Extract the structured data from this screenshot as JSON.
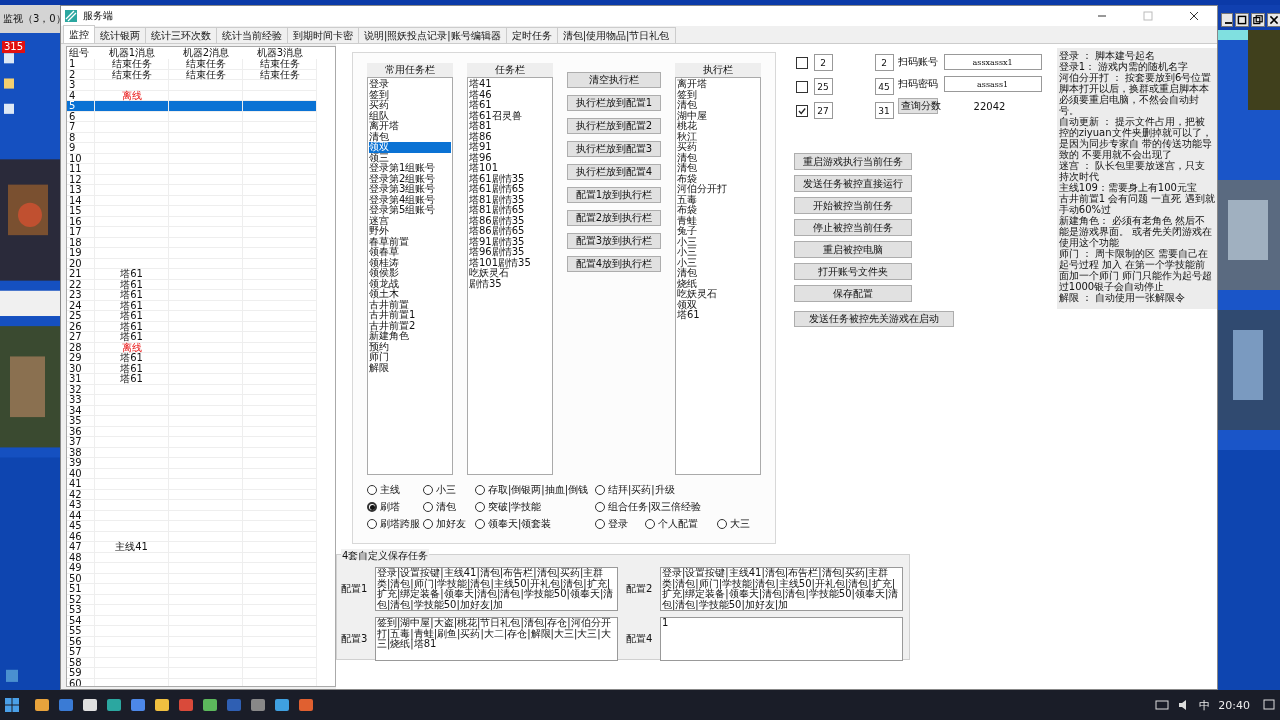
{
  "background_window": {
    "title": "监视（3，0）",
    "badge": "315"
  },
  "window": {
    "title": "服务端"
  },
  "tabs": [
    {
      "label": "监控",
      "selected": true
    },
    {
      "label": "统计银两",
      "selected": false
    },
    {
      "label": "统计三环次数",
      "selected": false
    },
    {
      "label": "统计当前经验",
      "selected": false
    },
    {
      "label": "到期时间卡密",
      "selected": false
    },
    {
      "label": "说明|照妖投点记录|账号编辑器",
      "selected": false
    },
    {
      "label": "定时任务",
      "selected": false
    },
    {
      "label": "清包|使用物品|节日礼包",
      "selected": false
    }
  ],
  "monitor_table": {
    "columns": [
      "组号",
      "机器1消息",
      "机器2消息",
      "机器3消息"
    ],
    "rows": [
      {
        "no": "1",
        "m1": "结束任务",
        "m2": "结束任务",
        "m3": "结束任务",
        "selected": false,
        "alert": false
      },
      {
        "no": "2",
        "m1": "结束任务",
        "m2": "结束任务",
        "m3": "结束任务",
        "selected": false,
        "alert": false
      },
      {
        "no": "3",
        "selected": false
      },
      {
        "no": "4",
        "m1": "离线",
        "selected": false,
        "alert": true
      },
      {
        "no": "5",
        "selected": true
      },
      {
        "no": "6",
        "selected": false
      },
      {
        "no": "7",
        "selected": false
      },
      {
        "no": "8",
        "selected": false
      },
      {
        "no": "9",
        "selected": false
      },
      {
        "no": "10",
        "selected": false
      },
      {
        "no": "11",
        "selected": false
      },
      {
        "no": "12",
        "selected": false
      },
      {
        "no": "13",
        "selected": false
      },
      {
        "no": "14",
        "selected": false
      },
      {
        "no": "15",
        "selected": false
      },
      {
        "no": "16",
        "selected": false
      },
      {
        "no": "17",
        "selected": false
      },
      {
        "no": "18",
        "selected": false
      },
      {
        "no": "19",
        "selected": false
      },
      {
        "no": "20",
        "selected": false
      },
      {
        "no": "21",
        "m1": "塔61",
        "selected": false,
        "alert": false
      },
      {
        "no": "22",
        "m1": "塔61",
        "selected": false,
        "alert": false
      },
      {
        "no": "23",
        "m1": "塔61",
        "selected": false,
        "alert": false
      },
      {
        "no": "24",
        "m1": "塔61",
        "selected": false,
        "alert": false
      },
      {
        "no": "25",
        "m1": "塔61",
        "selected": false,
        "alert": false
      },
      {
        "no": "26",
        "m1": "塔61",
        "selected": false,
        "alert": false
      },
      {
        "no": "27",
        "m1": "塔61",
        "selected": false,
        "alert": false
      },
      {
        "no": "28",
        "m1": "离线",
        "selected": false,
        "alert": true
      },
      {
        "no": "29",
        "m1": "塔61",
        "selected": false,
        "alert": false
      },
      {
        "no": "30",
        "m1": "塔61",
        "selected": false,
        "alert": false
      },
      {
        "no": "31",
        "m1": "塔61",
        "selected": false,
        "alert": false
      },
      {
        "no": "32",
        "selected": false
      },
      {
        "no": "33",
        "selected": false
      },
      {
        "no": "34",
        "selected": false
      },
      {
        "no": "35",
        "selected": false
      },
      {
        "no": "36",
        "selected": false
      },
      {
        "no": "37",
        "selected": false
      },
      {
        "no": "38",
        "selected": false
      },
      {
        "no": "39",
        "selected": false
      },
      {
        "no": "40",
        "selected": false
      },
      {
        "no": "41",
        "selected": false
      },
      {
        "no": "42",
        "selected": false
      },
      {
        "no": "43",
        "selected": false
      },
      {
        "no": "44",
        "selected": false
      },
      {
        "no": "45",
        "selected": false
      },
      {
        "no": "46",
        "selected": false
      },
      {
        "no": "47",
        "m1": "主线41",
        "selected": false,
        "alert": false
      },
      {
        "no": "48",
        "selected": false
      },
      {
        "no": "49",
        "selected": false
      },
      {
        "no": "50",
        "selected": false
      },
      {
        "no": "51",
        "selected": false
      },
      {
        "no": "52",
        "selected": false
      },
      {
        "no": "53",
        "selected": false
      },
      {
        "no": "54",
        "selected": false
      },
      {
        "no": "55",
        "selected": false
      },
      {
        "no": "56",
        "selected": false
      },
      {
        "no": "57",
        "selected": false
      },
      {
        "no": "58",
        "selected": false
      },
      {
        "no": "59",
        "selected": false
      },
      {
        "no": "60",
        "selected": false
      }
    ]
  },
  "common_tasks": {
    "title": "常用任务栏",
    "items": [
      {
        "label": "登录",
        "selected": false
      },
      {
        "label": "签到",
        "selected": false
      },
      {
        "label": "买药",
        "selected": false
      },
      {
        "label": "组队",
        "selected": false
      },
      {
        "label": "离开塔",
        "selected": false
      },
      {
        "label": "清包",
        "selected": false
      },
      {
        "label": "领双",
        "selected": true
      },
      {
        "label": "领三",
        "selected": false
      },
      {
        "label": "登录第1组账号",
        "selected": false
      },
      {
        "label": "登录第2组账号",
        "selected": false
      },
      {
        "label": "登录第3组账号",
        "selected": false
      },
      {
        "label": "登录第4组账号",
        "selected": false
      },
      {
        "label": "登录第5组账号",
        "selected": false
      },
      {
        "label": "迷宫",
        "selected": false
      },
      {
        "label": "野外",
        "selected": false
      },
      {
        "label": "春草前置",
        "selected": false
      },
      {
        "label": "领春草",
        "selected": false
      },
      {
        "label": "领桂涛",
        "selected": false
      },
      {
        "label": "领侯影",
        "selected": false
      },
      {
        "label": "领龙战",
        "selected": false
      },
      {
        "label": "领土木",
        "selected": false
      },
      {
        "label": "古井前置",
        "selected": false
      },
      {
        "label": "古井前置1",
        "selected": false
      },
      {
        "label": "古井前置2",
        "selected": false
      },
      {
        "label": "新建角色",
        "selected": false
      },
      {
        "label": "预约",
        "selected": false
      },
      {
        "label": "师门",
        "selected": false
      },
      {
        "label": "解限",
        "selected": false
      }
    ]
  },
  "tasks": {
    "title": "任务栏",
    "items": [
      "塔41",
      "塔46",
      "塔61",
      "塔61召灵兽",
      "塔81",
      "塔86",
      "塔91",
      "塔96",
      "塔101",
      "塔61剧情35",
      "塔61剧情65",
      "塔81剧情35",
      "塔81剧情65",
      "塔86剧情35",
      "塔86剧情65",
      "塔91剧情35",
      "塔96剧情35",
      "塔101剧情35",
      "吃妖灵石",
      "剧情35"
    ]
  },
  "task_buttons": [
    "清空执行栏",
    "执行栏放到配置1",
    "执行栏放到配置2",
    "执行栏放到配置3",
    "执行栏放到配置4",
    "配置1放到执行栏",
    "配置2放到执行栏",
    "配置3放到执行栏",
    "配置4放到执行栏"
  ],
  "exec_list": {
    "title": "执行栏",
    "items": [
      "离开塔",
      "签到",
      "清包",
      "湖中屋",
      "桃花",
      "秋江",
      "买药",
      "清包",
      "清包",
      "布袋",
      "河伯分开打",
      "五毒",
      "布袋",
      "青蛙",
      "兔子",
      "小三",
      "小三",
      "小三",
      "清包",
      "烧纸",
      "吃妖灵石",
      "领双",
      "塔61"
    ]
  },
  "modes": [
    [
      {
        "label": "主线",
        "selected": false
      },
      {
        "label": "小三",
        "selected": false
      },
      {
        "label": "存取|倒银两|抽血|倒钱",
        "selected": false
      },
      {
        "label": "结拜|买药|升级",
        "selected": false
      }
    ],
    [
      {
        "label": "刷塔",
        "selected": true
      },
      {
        "label": "清包",
        "selected": false
      },
      {
        "label": "突破|学技能",
        "selected": false
      },
      {
        "label": "组合任务|双三倍经验",
        "selected": false
      }
    ],
    [
      {
        "label": "刷塔跨服",
        "selected": false
      },
      {
        "label": "加好友",
        "selected": false
      },
      {
        "label": "领奉天|领套装",
        "selected": false
      },
      {
        "label": "登录",
        "selected": false
      },
      {
        "label": "个人配置",
        "selected": false
      },
      {
        "label": "大三",
        "selected": false
      }
    ]
  ],
  "presets": {
    "title": "4套自定义保存任务",
    "items": [
      {
        "label": "配置1",
        "value": "登录|设置按键|主线41|清包|布告栏|清包|买药|主群类|清包|师门|学技能|清包|主线50|开礼包|清包|扩充|扩充|绑定装备|领奉天|清包|清包|学技能50|领奉天|清包|清包|学技能50|加好友|加"
      },
      {
        "label": "配置2",
        "value": "登录|设置按键|主线41|清包|布告栏|清包|买药|主群类|清包|师门|学技能|清包|主线50|开礼包|清包|扩充|扩充|绑定装备|领奉天|清包|清包|学技能50|领奉天|清包|清包|学技能50|加好友|加"
      },
      {
        "label": "配置3",
        "value": "签到|湖中屋|大盗|桃花|节日礼包|清包|存仓|河伯分开打|五毒|青蛙|刷鱼|买药|大二|存仓|解限|大三|大三|大三|烧纸|塔81"
      },
      {
        "label": "配置4",
        "value": "1"
      }
    ]
  },
  "counters": [
    {
      "checked": false,
      "first": "2",
      "second": "2"
    },
    {
      "checked": false,
      "first": "25",
      "second": "45"
    },
    {
      "checked": true,
      "first": "27",
      "second": "31"
    }
  ],
  "scan_account": {
    "label": "扫码账号",
    "value": "assxassx1"
  },
  "scan_password": {
    "label": "扫码密码",
    "value": "assass1"
  },
  "query_button": "查询分数",
  "score": "22042",
  "control_buttons": [
    "重启游戏执行当前任务",
    "发送任务被控直接运行",
    "开始被控当前任务",
    "停止被控当前任务",
    "重启被控电脑",
    "打开账号文件夹",
    "保存配置"
  ],
  "wide_button": "发送任务被控先关游戏在启动",
  "notes": [
    "登录 ： 脚本建号起名",
    "登录1： 游戏内需的随机名字",
    "河伯分开打 ： 按套要放到6号位置",
    "脚本打开以后，换群或重启脚本本必须要重启电脑，不然会自动封号。",
    "自动更新 ： 提示文件占用，把被控的ziyuan文件夹删掉就可以了，是因为同步专家自 带的传送功能导致的 不要用就不会出现了",
    "迷宫 ： 队长包里要放迷宫，只支持次时代",
    "主线109：需要身上有100元宝",
    "古井前置1 会有问题 一直死  遇到就手动60%过",
    "新建角色： 必须有老角色 然后不能是游戏界面。 或者先关闭游戏在使用这个功能",
    "师门 ： 周卡限制的区  需要自己在起号过程 加入  在第一个学技能前面加一个师门  师门只能作为起号超过1000银子会自动停止",
    "解限 ： 自动使用一张解限令"
  ],
  "taskbar": {
    "ime": "中",
    "clock": "20:40"
  }
}
